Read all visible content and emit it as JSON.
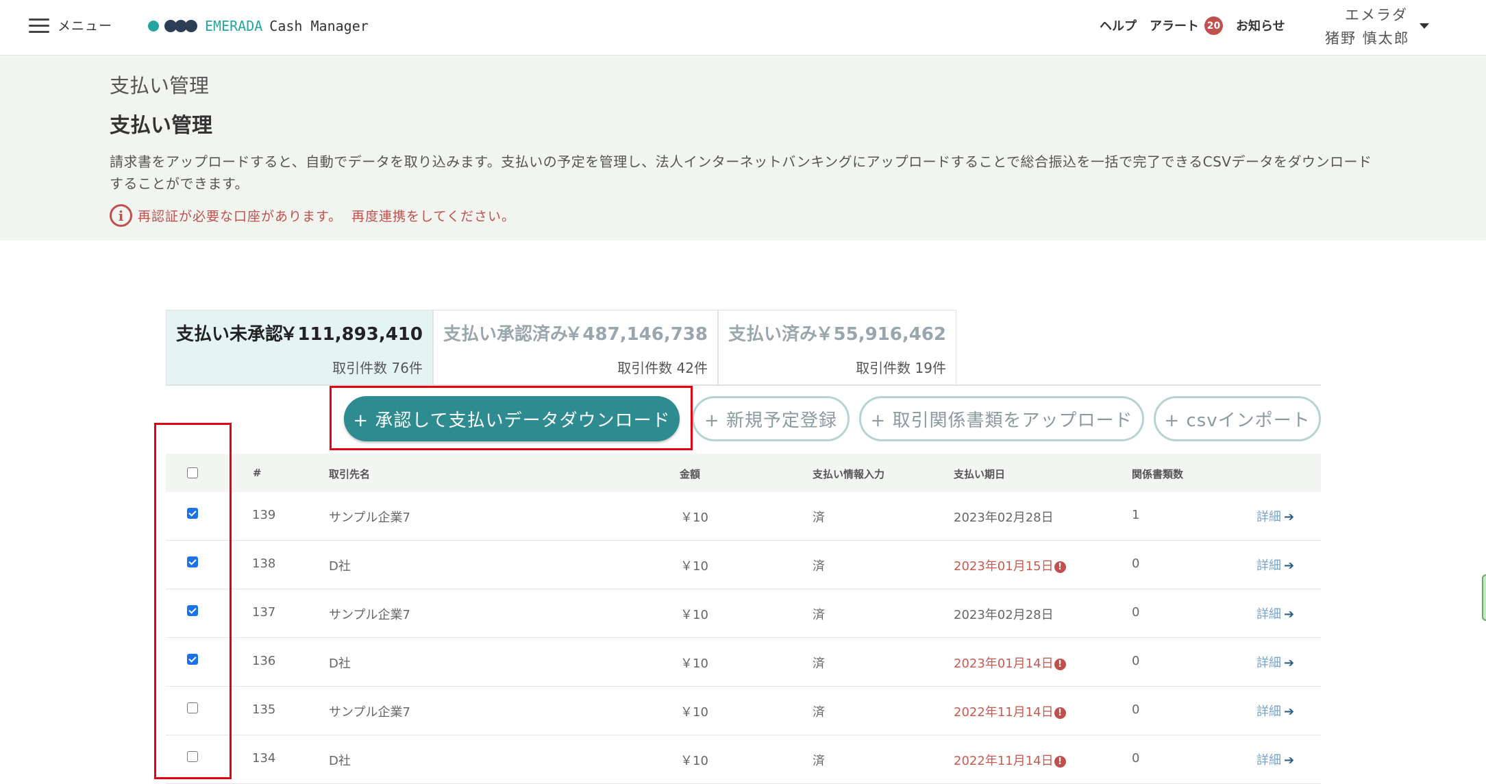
{
  "header": {
    "menu_label": "メニュー",
    "brand": "EMERADA",
    "product": "Cash Manager",
    "help": "ヘルプ",
    "alert": "アラート",
    "alert_count": "20",
    "news": "お知らせ",
    "user_org": "エメラダ",
    "user_name": "猪野 慎太郎"
  },
  "page": {
    "breadcrumb": "支払い管理",
    "title": "支払い管理",
    "description": "請求書をアップロードすると、自動でデータを取り込みます。支払いの予定を管理し、法人インターネットバンキングにアップロードすることで総合振込を一括で完了できるCSVデータをダウンロードすることができます。",
    "warning_text": "再認証が必要な口座があります。",
    "warning_link": "再度連携をしてください。"
  },
  "tabs": [
    {
      "title": "支払い未承認",
      "amount": "￥111,893,410",
      "count": "取引件数 76件",
      "active": true
    },
    {
      "title": "支払い承認済み",
      "amount": "￥487,146,738",
      "count": "取引件数 42件",
      "active": false
    },
    {
      "title": "支払い済み",
      "amount": "￥55,916,462",
      "count": "取引件数 19件",
      "active": false
    }
  ],
  "actions": {
    "approve_download": "+ 承認して支払いデータダウンロード",
    "new_schedule": "+ 新規予定登録",
    "upload_docs": "+ 取引関係書類をアップロード",
    "csv_import": "+ csvインポート"
  },
  "table": {
    "columns": [
      "#",
      "取引先名",
      "金額",
      "支払い情報入力",
      "支払い期日",
      "関係書類数"
    ],
    "detail_label": "詳細",
    "rows": [
      {
        "id": "139",
        "vendor": "サンプル企業7",
        "amount": "￥10",
        "info": "済",
        "due": "2023年02月28日",
        "overdue": false,
        "docs": "1",
        "checked": true
      },
      {
        "id": "138",
        "vendor": "D社",
        "amount": "￥10",
        "info": "済",
        "due": "2023年01月15日",
        "overdue": true,
        "docs": "0",
        "checked": true
      },
      {
        "id": "137",
        "vendor": "サンプル企業7",
        "amount": "￥10",
        "info": "済",
        "due": "2023年02月28日",
        "overdue": false,
        "docs": "0",
        "checked": true
      },
      {
        "id": "136",
        "vendor": "D社",
        "amount": "￥10",
        "info": "済",
        "due": "2023年01月14日",
        "overdue": true,
        "docs": "0",
        "checked": true
      },
      {
        "id": "135",
        "vendor": "サンプル企業7",
        "amount": "￥10",
        "info": "済",
        "due": "2022年11月14日",
        "overdue": true,
        "docs": "0",
        "checked": false
      },
      {
        "id": "134",
        "vendor": "D社",
        "amount": "￥10",
        "info": "済",
        "due": "2022年11月14日",
        "overdue": true,
        "docs": "0",
        "checked": false
      }
    ]
  },
  "colors": {
    "accent": "#2e8b8f",
    "brand": "#23a6a0",
    "overdue": "#c0504d",
    "highlight": "#e50012"
  }
}
